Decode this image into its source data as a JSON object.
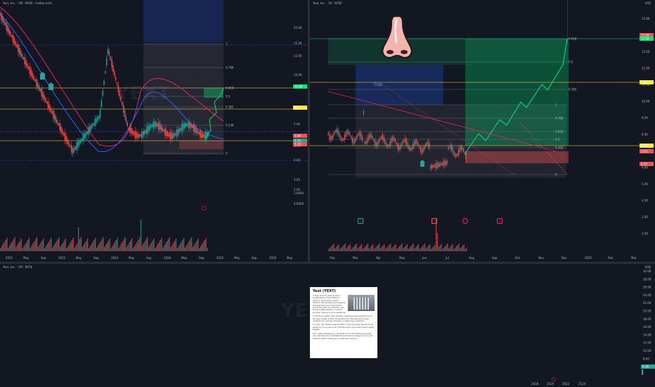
{
  "colors": {
    "background": "#131722",
    "bull": "#26a69a",
    "bear": "#ef5350",
    "accent_yellow": "#ffeb3b",
    "accent_green": "#00e676",
    "fib_box": "#2962ff",
    "ma_red": "#e91e63",
    "ma_blue": "#2962ff"
  },
  "top_left": {
    "legend": "Yext, Inc. · 1W · NYSE · FinBox·AxiS",
    "watermark": "YEXT",
    "y_labels": [
      "25.00",
      "15.00",
      "12.00",
      "10.00",
      "7.00",
      "6.00",
      "5.00",
      "4.00",
      "3.00",
      "2.00",
      "1.0000",
      "0.0000"
    ],
    "x_labels": [
      "2021",
      "May",
      "Sep",
      "2022",
      "May",
      "Sep",
      "2023",
      "May",
      "Sep",
      "2024",
      "May",
      "Sep",
      "2025",
      "May",
      "Sep",
      "2026",
      "May"
    ],
    "fib_labels": [
      "1",
      "0.786",
      "0.618",
      "0.5",
      "0.382",
      "0.236",
      "0"
    ],
    "price_tags": [
      "10.80",
      "8.53",
      "5.84",
      "5.75",
      "5.29"
    ]
  },
  "top_right": {
    "legend": "Yext, Inc. · 1D · NYSE",
    "usd": "USD",
    "gap_label": "Gap",
    "y_labels": [
      "15.00",
      "14.00",
      "13.00",
      "12.00",
      "11.00",
      "10.00",
      "9.00",
      "8.00",
      "7.00",
      "6.00",
      "5.00",
      "4.00",
      "3.00",
      "2.00"
    ],
    "x_labels": [
      "Feb",
      "Mar",
      "Apr",
      "May",
      "Jun",
      "Jul",
      "Aug",
      "Sep",
      "Oct",
      "Nov",
      "Dec",
      "2025",
      "Feb",
      "Mar"
    ],
    "fib_labels": [
      "0.618",
      "0.5",
      "0.382",
      "1",
      "0.786",
      "0.618",
      "0.5",
      "0.382",
      "0"
    ],
    "price_tags": [
      "13.59",
      "12.56",
      "9.40",
      "6.29",
      "5.93",
      "3.25"
    ],
    "nose_icon": "nose-emoji-icon"
  },
  "bottom": {
    "legend": "Yext, Inc. · 1M · NYSE",
    "usd": "USD",
    "watermark": "YEXT",
    "y_labels": [
      "30.00",
      "28.00",
      "26.00",
      "24.00",
      "22.00",
      "20.00",
      "18.00",
      "16.00",
      "14.00",
      "12.00",
      "10.00",
      "8.00",
      "6.00"
    ],
    "x_labels": [
      "2018",
      "2020",
      "2022",
      "2124"
    ],
    "price_tag": "6.58"
  },
  "info_card": {
    "title": "Yext (YEXT)",
    "paragraphs": [
      "In New York City stands Yext's headquarters at One Madison Avenue. Yext builds a search platform that enables businesses to manage their brand information across the web, so customers can find accurate answers on search engines, maps and voice assistants.",
      "In the third quarter, the company reported revenue growth and a stronger margin profile; the guidance for the next period was raised as the company focuses on enterprise customers.",
      "In order, the market rewards what it cannot yet see; the stock has based for a long period and the structure now points toward higher targets.",
      "The content displayed on the chart is for informational purposes only and does not constitute financial advice. Always do your own research before making any investment decision."
    ]
  }
}
